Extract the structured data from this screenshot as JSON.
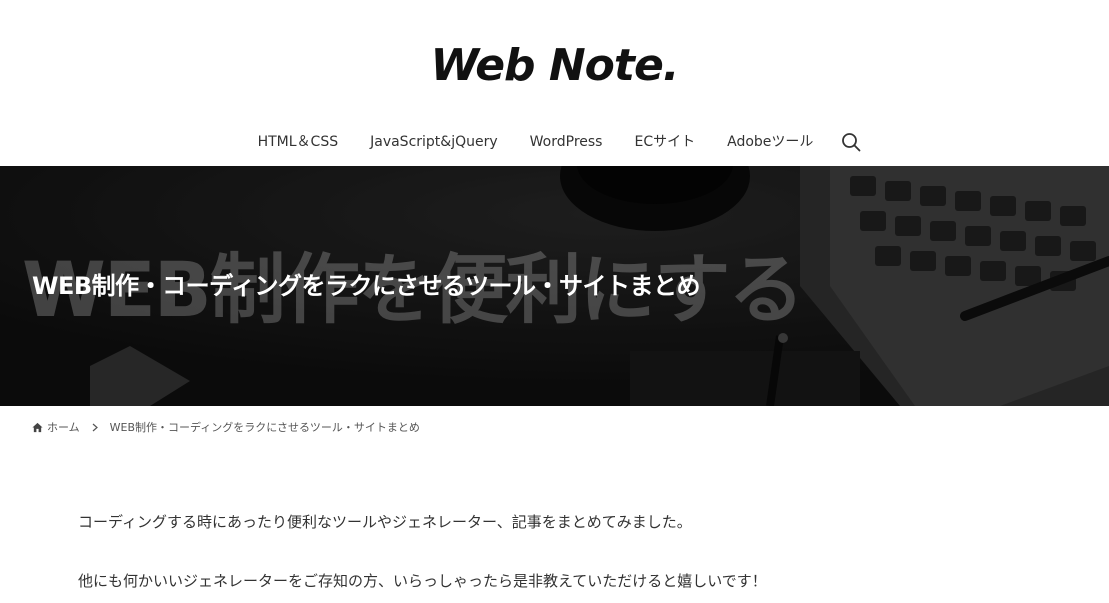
{
  "site": {
    "logo": "Web Note."
  },
  "nav": {
    "items": [
      {
        "label": "HTML＆CSS"
      },
      {
        "label": "JavaScript&jQuery"
      },
      {
        "label": "WordPress"
      },
      {
        "label": "ECサイト"
      },
      {
        "label": "Adobeツール"
      }
    ],
    "search_icon": "search-icon"
  },
  "hero": {
    "bg_text": "WEB制作を便利にする",
    "title": "WEB制作・コーディングをラクにさせるツール・サイトまとめ"
  },
  "breadcrumb": {
    "home_icon": "home-icon",
    "home": "ホーム",
    "separator_icon": "chevron-right-icon",
    "current": "WEB制作・コーディングをラクにさせるツール・サイトまとめ"
  },
  "content": {
    "paragraphs": [
      "コーディングする時にあったり便利なツールやジェネレーター、記事をまとめてみました。",
      "他にも何かいいジェネレーターをご存知の方、いらっしゃったら是非教えていただけると嬉しいです！"
    ]
  },
  "colors": {
    "hero_bg": "#1a1a1a",
    "text": "#333333",
    "logo": "#111111"
  }
}
